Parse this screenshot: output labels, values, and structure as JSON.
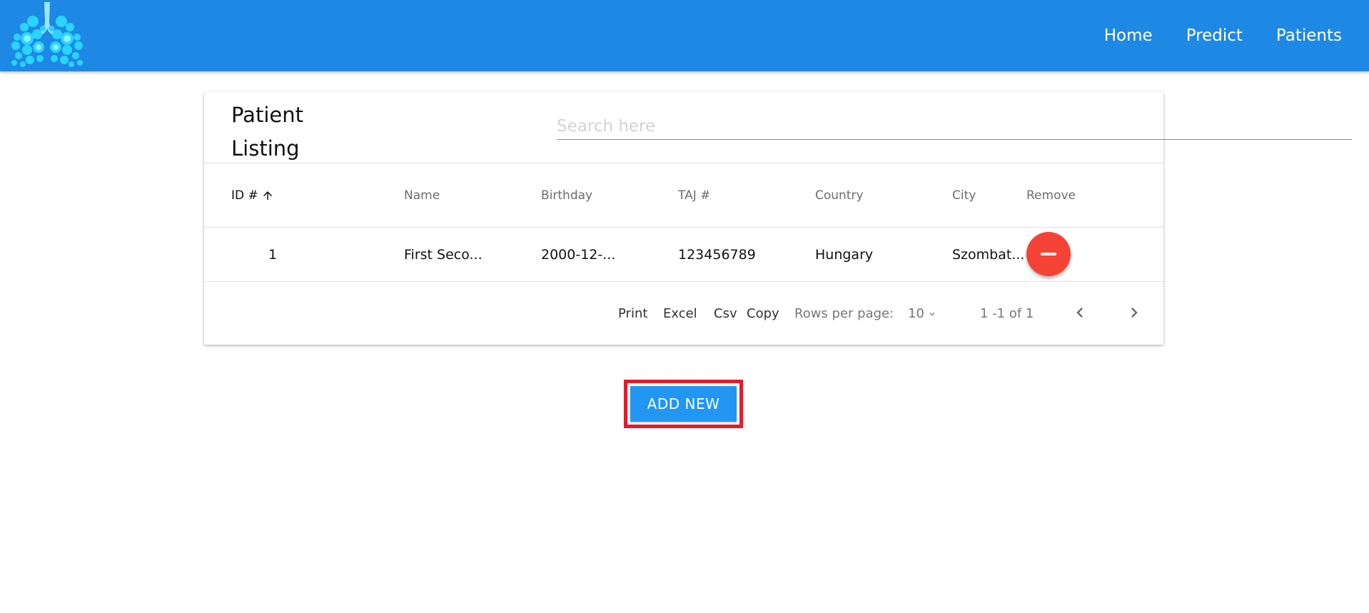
{
  "colors": {
    "header": "#1e88e5",
    "remove_button": "#f44336",
    "add_button": "#2196f3",
    "highlight_border": "#e51b2b"
  },
  "header": {
    "logo_icon": "lungs-icon",
    "nav": [
      {
        "label": "Home"
      },
      {
        "label": "Predict"
      },
      {
        "label": "Patients"
      }
    ]
  },
  "listing": {
    "title": "Patient Listing",
    "search_placeholder": "Search here",
    "search_value": "",
    "columns": [
      "ID #",
      "Name",
      "Birthday",
      "TAJ #",
      "Country",
      "City",
      "Remove"
    ],
    "sort": {
      "column": "ID #",
      "direction": "ascending"
    },
    "rows": [
      {
        "id": "1",
        "name": "First Seco...",
        "birthday": "2000-12-...",
        "taj": "123456789",
        "country": "Hungary",
        "city": "Szombat..."
      }
    ],
    "footer": {
      "actions": [
        "Print",
        "Excel",
        "Csv",
        "Copy"
      ],
      "rows_per_page_label": "Rows per page:",
      "rows_per_page_value": "10",
      "page_info": "1 -1 of 1"
    }
  },
  "add_button_label": "ADD NEW"
}
